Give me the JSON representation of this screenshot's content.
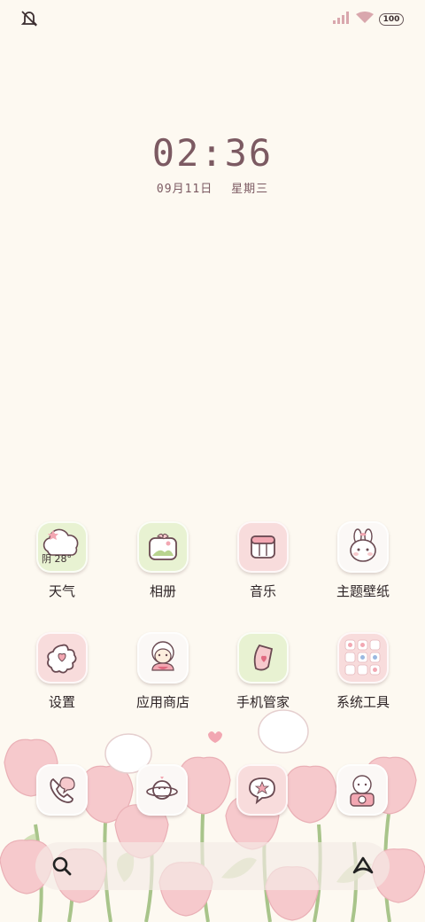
{
  "status": {
    "battery": "100"
  },
  "clock": {
    "time": "02:36",
    "date": "09月11日",
    "weekday": "星期三"
  },
  "weather": {
    "condition": "阴",
    "temp": "28°"
  },
  "apps": [
    {
      "label": "天气",
      "icon": "cloud-icon"
    },
    {
      "label": "相册",
      "icon": "photo-album-icon"
    },
    {
      "label": "音乐",
      "icon": "music-icon"
    },
    {
      "label": "主题壁纸",
      "icon": "theme-bunny-icon"
    },
    {
      "label": "设置",
      "icon": "flower-heart-icon"
    },
    {
      "label": "应用商店",
      "icon": "sheep-girl-icon"
    },
    {
      "label": "手机管家",
      "icon": "shield-heart-icon"
    },
    {
      "label": "系统工具",
      "icon": "tools-grid-icon"
    }
  ],
  "dock": [
    {
      "icon": "phone-icon"
    },
    {
      "icon": "planet-icon"
    },
    {
      "icon": "message-star-icon"
    },
    {
      "icon": "camera-icon"
    }
  ],
  "colors": {
    "background": "#fdf9f1",
    "clock": "#7c5a62",
    "pink": "#f8dcdc",
    "green": "#e8f2d2",
    "white": "#fbf8f6"
  }
}
